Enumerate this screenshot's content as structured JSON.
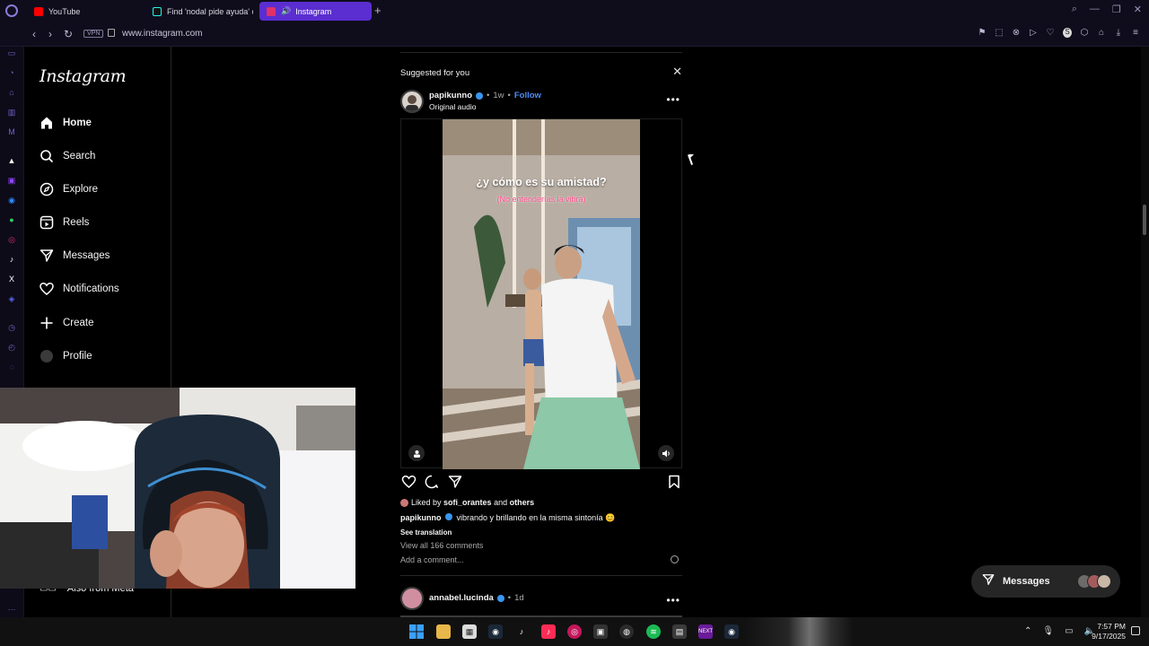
{
  "browser": {
    "tabs": [
      {
        "label": "YouTube",
        "color": "#ff0000"
      },
      {
        "label": "Find 'nodal pide ayuda' o",
        "color": "#25f4ee"
      },
      {
        "label": "Instagram",
        "color": "#e1306c"
      }
    ],
    "new_tab": "+",
    "vpn": "VPN",
    "url": "www.instagram.com"
  },
  "nav": {
    "logo": "Instagram",
    "items": [
      {
        "label": "Home",
        "icon": "home-icon"
      },
      {
        "label": "Search",
        "icon": "search-icon"
      },
      {
        "label": "Explore",
        "icon": "compass-icon"
      },
      {
        "label": "Reels",
        "icon": "reels-icon"
      },
      {
        "label": "Messages",
        "icon": "messenger-icon"
      },
      {
        "label": "Notifications",
        "icon": "heart-icon"
      },
      {
        "label": "Create",
        "icon": "plus-icon"
      },
      {
        "label": "Profile",
        "icon": "avatar-icon"
      }
    ],
    "also_from_meta": "Also from Meta"
  },
  "feed": {
    "suggested_label": "Suggested for you",
    "post": {
      "username": "papikunno",
      "separator": "•",
      "time": "1w",
      "follow": "Follow",
      "audio": "Original audio",
      "caption_line1": "¿y cómo es su amistad?",
      "caption_line2": "(No entenderías la vibra)",
      "liked_prefix": "Liked by",
      "liked_user": "sofi_orantes",
      "liked_and": "and",
      "liked_others": "others",
      "caption_user": "papikunno",
      "caption_text": "vibrando y brillando en la misma sintonía 😊",
      "see_translation": "See translation",
      "view_comments": "View all 166 comments",
      "add_comment": "Add a comment..."
    },
    "next_post": {
      "username": "annabel.lucinda",
      "separator": "•",
      "time": "1d"
    }
  },
  "messages_pill": {
    "label": "Messages"
  },
  "taskbar": {
    "time": "7:57 PM",
    "date": "9/17/2025"
  },
  "colors": {
    "accent": "#5a2ed0",
    "verified": "#3897f0",
    "follow": "#4f8df6"
  }
}
